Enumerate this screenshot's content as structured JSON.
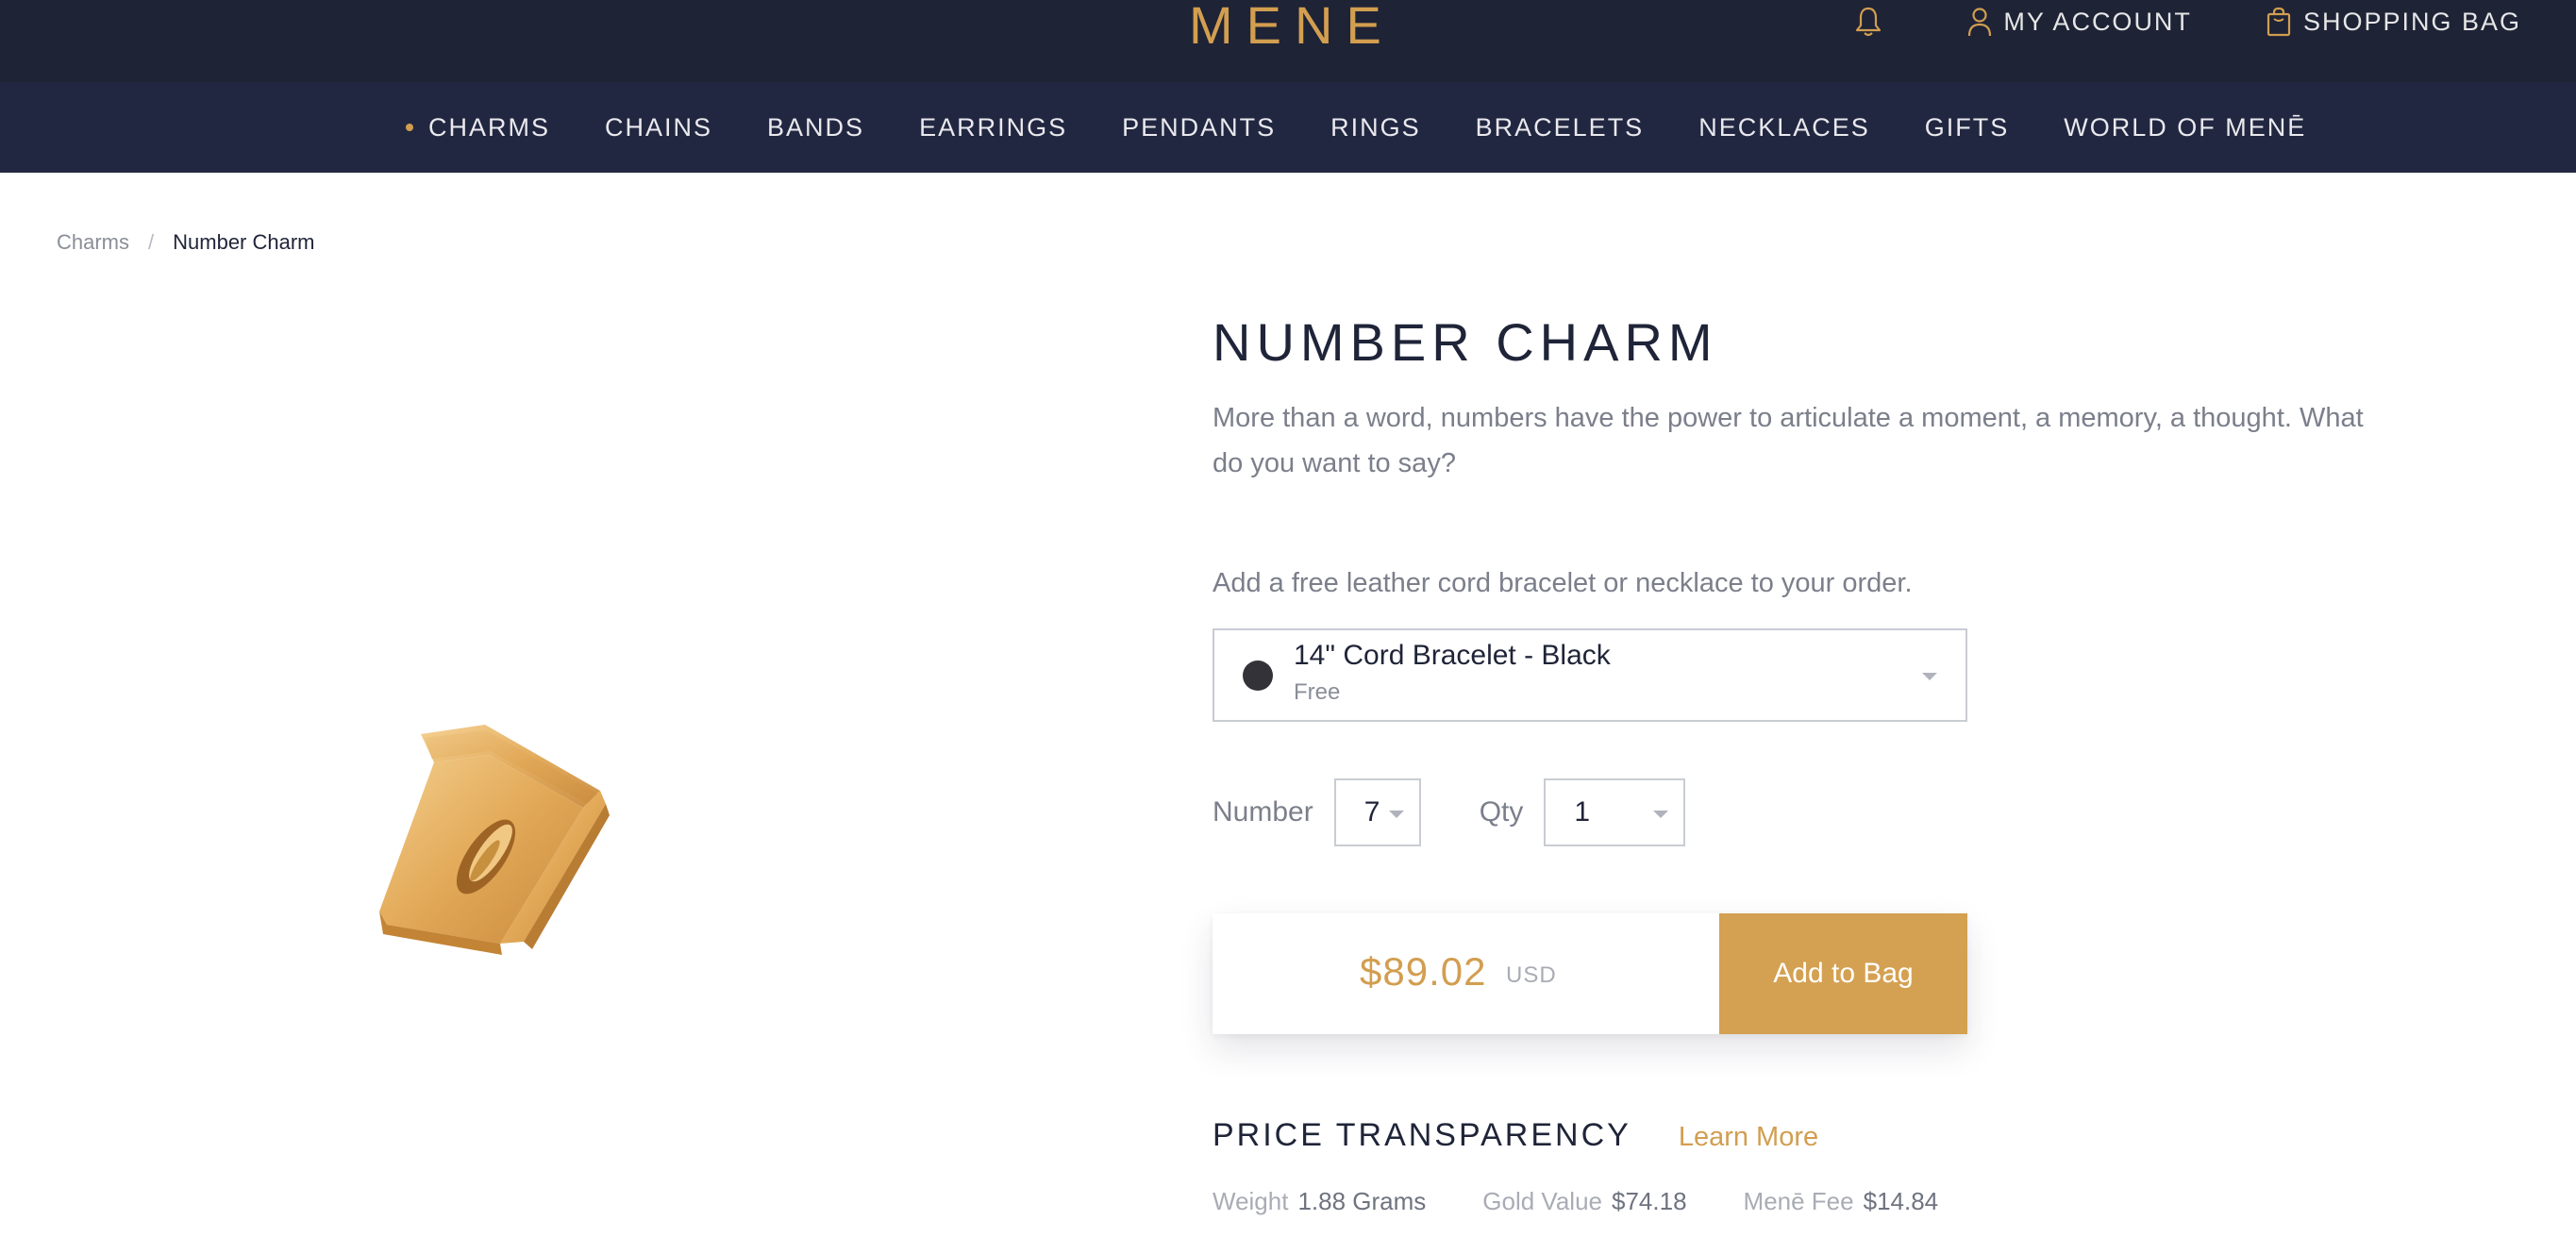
{
  "header": {
    "logo": "MENE",
    "account_label": "MY ACCOUNT",
    "bag_label": "SHOPPING BAG",
    "icons": [
      "bell-icon",
      "user-icon",
      "shopping-bag-icon"
    ]
  },
  "nav": {
    "items": [
      {
        "label": "CHARMS",
        "active": true
      },
      {
        "label": "CHAINS"
      },
      {
        "label": "BANDS"
      },
      {
        "label": "EARRINGS"
      },
      {
        "label": "PENDANTS"
      },
      {
        "label": "RINGS"
      },
      {
        "label": "BRACELETS"
      },
      {
        "label": "NECKLACES"
      },
      {
        "label": "GIFTS"
      },
      {
        "label": "WORLD OF MENĒ"
      }
    ]
  },
  "breadcrumb": {
    "parent": "Charms",
    "separator": "/",
    "current": "Number Charm"
  },
  "product": {
    "title": "NUMBER CHARM",
    "description": "More than a word, numbers have the power to articulate a moment, a memory, a thought. What do you want to say?",
    "addon_label": "Add a free leather cord bracelet or necklace to your order.",
    "addon_select": {
      "value": "14\" Cord Bracelet - Black",
      "price": "Free",
      "swatch_color": "#323238"
    },
    "number_label": "Number",
    "number_value": "7",
    "qty_label": "Qty",
    "qty_value": "1",
    "price": "$89.02",
    "currency": "USD",
    "add_to_bag": "Add to Bag"
  },
  "transparency": {
    "title": "PRICE TRANSPARENCY",
    "learn_more": "Learn More",
    "metrics": [
      {
        "label": "Weight",
        "value": "1.88 Grams"
      },
      {
        "label": "Gold Value",
        "value": "$74.18"
      },
      {
        "label": "Menē Fee",
        "value": "$14.84"
      }
    ]
  },
  "colors": {
    "header_bg": "#1e2336",
    "nav_bg": "#222741",
    "accent_gold": "#d29e50",
    "button_gold": "#d4a152"
  }
}
